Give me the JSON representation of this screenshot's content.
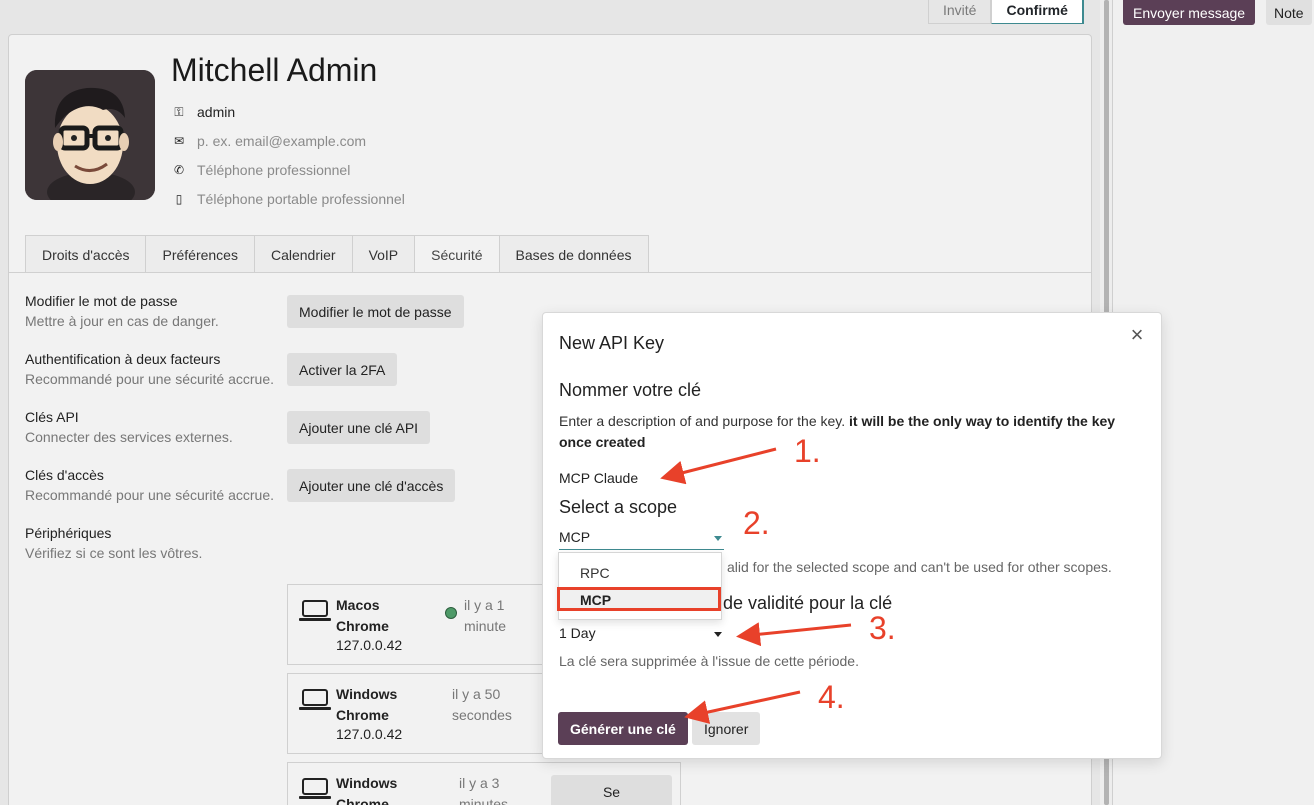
{
  "statusbar": {
    "steps": [
      "Invité",
      "Confirmé"
    ],
    "active": "Confirmé"
  },
  "chatter": {
    "send_label": "Envoyer message",
    "note_label": "Note"
  },
  "user": {
    "name": "Mitchell Admin",
    "login": "admin",
    "email_placeholder": "p. ex. email@example.com",
    "phone_placeholder": "Téléphone professionnel",
    "mobile_placeholder": "Téléphone portable professionnel"
  },
  "tabs": [
    {
      "label": "Droits d'accès"
    },
    {
      "label": "Préférences"
    },
    {
      "label": "Calendrier"
    },
    {
      "label": "VoIP"
    },
    {
      "label": "Sécurité"
    },
    {
      "label": "Bases de données"
    }
  ],
  "security": {
    "sections": [
      {
        "title": "Modifier le mot de passe",
        "desc": "Mettre à jour en cas de danger.",
        "button": "Modifier le mot de passe"
      },
      {
        "title": "Authentification à deux facteurs",
        "desc": "Recommandé pour une sécurité accrue.",
        "button": "Activer la 2FA"
      },
      {
        "title": "Clés API",
        "desc": "Connecter des services externes.",
        "button": "Ajouter une clé API"
      },
      {
        "title": "Clés d'accès",
        "desc": "Recommandé pour une sécurité accrue.",
        "button": "Ajouter une clé d'accès"
      },
      {
        "title": "Périphériques",
        "desc": "Vérifiez si ce sont les vôtres."
      }
    ],
    "devices": [
      {
        "os": "Macos",
        "browser": "Chrome",
        "ip": "127.0.0.42",
        "when1": "il y a 1",
        "when2": "minute",
        "active": true
      },
      {
        "os": "Windows",
        "browser": "Chrome",
        "ip": "127.0.0.42",
        "when1": "il y a 50",
        "when2": "secondes",
        "active": false
      },
      {
        "os": "Windows",
        "browser": "Chrome",
        "ip": "",
        "when1": "il y a 3",
        "when2": "minutes",
        "active": false,
        "button": "Se"
      }
    ]
  },
  "modal": {
    "title": "New API Key",
    "name_heading": "Nommer votre clé",
    "desc_plain": "Enter a description of and purpose for the key.",
    "desc_bold": "it will be the only way to identify the key once created",
    "key_name": "MCP Claude",
    "scope_heading": "Select a scope",
    "scope_value": "MCP",
    "scope_hint": "alid for the selected scope and can't be used for other scopes.",
    "scope_options": [
      "RPC",
      "MCP"
    ],
    "validity_heading": "de validité pour la clé",
    "validity_value": "1 Day",
    "validity_hint": "La clé sera supprimée à l'issue de cette période.",
    "generate_label": "Générer une clé",
    "ignore_label": "Ignorer"
  },
  "annotations": {
    "steps": [
      "1.",
      "2.",
      "3.",
      "4."
    ],
    "color": "#e8412a"
  },
  "colors": {
    "brand": "#5b3f56",
    "accent": "#3e8a90",
    "active_dot": "#4e9a68"
  }
}
